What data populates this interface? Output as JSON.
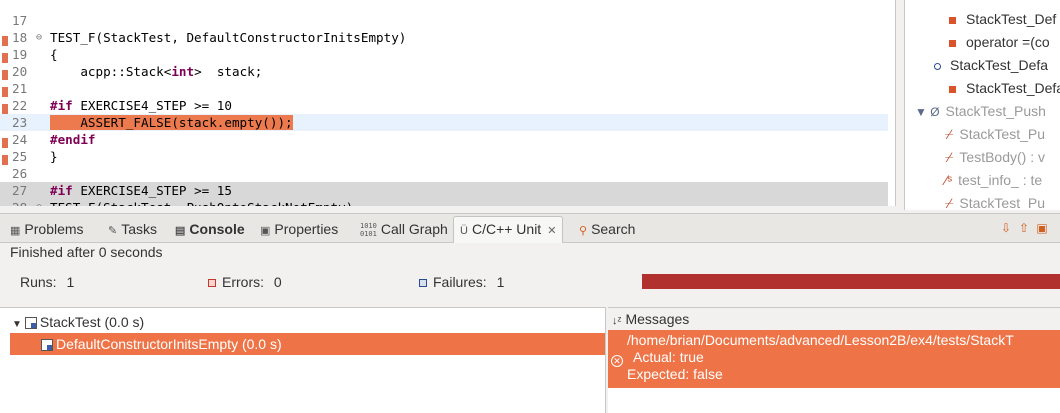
{
  "editor": {
    "lines": [
      {
        "num": "17",
        "segments": [
          {
            "t": "",
            "c": ""
          }
        ]
      },
      {
        "num": "18",
        "fold": "⊖",
        "segments": [
          {
            "t": "TEST_F(StackTest, DefaultConstructorInitsEmpty)",
            "c": ""
          }
        ]
      },
      {
        "num": "19",
        "segments": [
          {
            "t": "{",
            "c": ""
          }
        ]
      },
      {
        "num": "20",
        "segments": [
          {
            "t": "    acpp::Stack<",
            "c": ""
          },
          {
            "t": "int",
            "c": "kw"
          },
          {
            "t": ">  stack;",
            "c": ""
          }
        ]
      },
      {
        "num": "21",
        "segments": [
          {
            "t": "",
            "c": ""
          }
        ]
      },
      {
        "num": "22",
        "segments": [
          {
            "t": "#if",
            "c": "kw"
          },
          {
            "t": " EXERCISE4_STEP >= 10",
            "c": ""
          }
        ]
      },
      {
        "num": "23",
        "current": true,
        "segments": [
          {
            "t": "    ASSERT_FALSE(stack.empty());",
            "c": "hl"
          }
        ]
      },
      {
        "num": "24",
        "segments": [
          {
            "t": "#endif",
            "c": "kw"
          }
        ]
      },
      {
        "num": "25",
        "segments": [
          {
            "t": "}",
            "c": ""
          }
        ]
      },
      {
        "num": "26",
        "segments": [
          {
            "t": "",
            "c": ""
          }
        ]
      },
      {
        "num": "27",
        "grey": true,
        "segments": [
          {
            "t": "#if",
            "c": "kw"
          },
          {
            "t": " EXERCISE4_STEP >= 15",
            "c": ""
          }
        ]
      },
      {
        "num": "28",
        "fold": "⊖",
        "grey": true,
        "segments": [
          {
            "t": "TEST_F(StackTest, PushOntoStackNotEmpty)",
            "c": ""
          }
        ]
      }
    ]
  },
  "outline": {
    "items": [
      {
        "label": "StackTest_Def",
        "icon": "private-member-icon",
        "dim": false
      },
      {
        "label": "operator =(co",
        "icon": "private-member-icon",
        "dim": false
      },
      {
        "label": "StackTest_Defa",
        "icon": "public-member-icon",
        "dim": false
      },
      {
        "label": "StackTest_Defa",
        "icon": "private-member-icon",
        "dim": false
      },
      {
        "label": "StackTest_Push",
        "icon": "class-icon",
        "dim": true
      },
      {
        "label": "StackTest_Pu",
        "icon": "inactive-member-icon",
        "dim": true
      },
      {
        "label": "TestBody() : v",
        "icon": "inactive-member-icon",
        "dim": true
      },
      {
        "label": "test_info_ : te",
        "icon": "static-field-icon",
        "dim": true
      },
      {
        "label": "StackTest_Pu",
        "icon": "inactive-member-icon",
        "dim": true
      }
    ]
  },
  "tabs": {
    "problems": "Problems",
    "tasks": "Tasks",
    "console": "Console",
    "properties": "Properties",
    "call_graph": "Call Graph",
    "unit": "C/C++ Unit",
    "search": "Search",
    "call_graph_icon_text": "1010\n0101"
  },
  "unit": {
    "status": "Finished after 0 seconds",
    "runs_label": "Runs:",
    "runs_value": "1",
    "errors_label": "Errors:",
    "errors_value": "0",
    "failures_label": "Failures:",
    "failures_value": "1",
    "progress_failed": true,
    "progress_color": "#b0312e",
    "tree": [
      {
        "label": "StackTest (0.0 s)",
        "selected": false
      },
      {
        "label": "DefaultConstructorInitsEmpty (0.0 s)",
        "selected": true
      }
    ],
    "messages_header": "Messages",
    "messages": [
      "/home/brian/Documents/advanced/Lesson2B/ex4/tests/StackT",
      "Actual: true",
      "Expected: false"
    ]
  },
  "colors": {
    "accent": "#ee7447",
    "keyword": "#7f0055",
    "failure_bar": "#b0312e"
  }
}
